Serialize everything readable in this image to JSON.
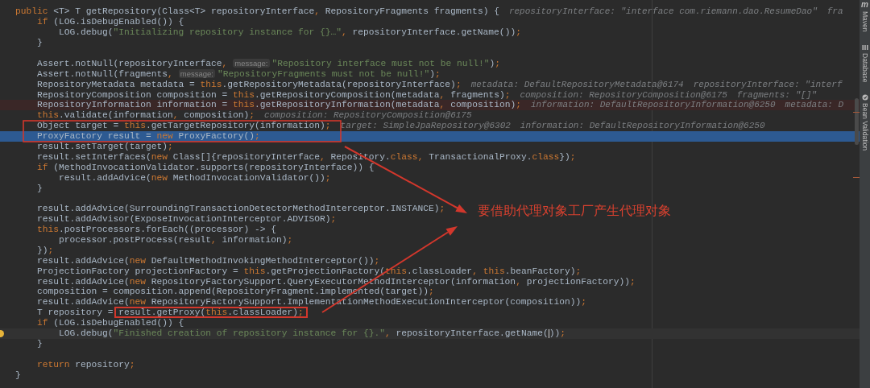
{
  "editor": {
    "lines": [
      {
        "kind": "plain",
        "tokens": [
          {
            "kind": "keyword",
            "text": "public"
          },
          {
            "kind": "plain",
            "text": " <T> T getRepository(Class<T> repositoryInterface"
          },
          {
            "kind": "keyword",
            "text": ","
          },
          {
            "kind": "plain",
            "text": " RepositoryFragments fragments) {"
          }
        ],
        "inline_values": [
          "repositoryInterface: \"interface com.riemann.dao.ResumeDao\"",
          "fra"
        ]
      },
      {
        "kind": "plain",
        "tokens": [
          {
            "kind": "keyword",
            "text": "    if"
          },
          {
            "kind": "plain",
            "text": " (LOG.isDebugEnabled()) {"
          }
        ]
      },
      {
        "kind": "plain",
        "tokens": [
          {
            "kind": "plain",
            "text": "        LOG.debug("
          },
          {
            "kind": "string",
            "text": "\"Initializing repository instance for {}…\""
          },
          {
            "kind": "keyword",
            "text": ","
          },
          {
            "kind": "plain",
            "text": " repositoryInterface.getName())"
          },
          {
            "kind": "keyword",
            "text": ";"
          }
        ]
      },
      {
        "kind": "plain",
        "tokens": [
          {
            "kind": "plain",
            "text": "    }"
          }
        ]
      },
      {
        "kind": "plain"
      },
      {
        "kind": "plain",
        "tokens": [
          {
            "kind": "plain",
            "text": "    Assert.notNull(repositoryInterface"
          },
          {
            "kind": "keyword",
            "text": ","
          },
          {
            "kind": "param_hint",
            "text": "message:"
          },
          {
            "kind": "string",
            "text": "\"Repository interface must not be null!\""
          },
          {
            "kind": "plain",
            "text": ")"
          },
          {
            "kind": "keyword",
            "text": ";"
          }
        ]
      },
      {
        "kind": "plain",
        "tokens": [
          {
            "kind": "plain",
            "text": "    Assert.notNull(fragments"
          },
          {
            "kind": "keyword",
            "text": ","
          },
          {
            "kind": "param_hint",
            "text": "message:"
          },
          {
            "kind": "string",
            "text": "\"RepositoryFragments must not be null!\""
          },
          {
            "kind": "plain",
            "text": ")"
          },
          {
            "kind": "keyword",
            "text": ";"
          }
        ]
      },
      {
        "kind": "plain",
        "tokens": [
          {
            "kind": "plain",
            "text": "    RepositoryMetadata metadata = "
          },
          {
            "kind": "keyword",
            "text": "this"
          },
          {
            "kind": "plain",
            "text": ".getRepositoryMetadata(repositoryInterface)"
          },
          {
            "kind": "keyword",
            "text": ";"
          }
        ],
        "inline_values": [
          "metadata: DefaultRepositoryMetadata@6174",
          "repositoryInterface: \"interf"
        ]
      },
      {
        "kind": "plain",
        "tokens": [
          {
            "kind": "plain",
            "text": "    RepositoryComposition composition = "
          },
          {
            "kind": "keyword",
            "text": "this"
          },
          {
            "kind": "plain",
            "text": ".getRepositoryComposition(metadata"
          },
          {
            "kind": "keyword",
            "text": ","
          },
          {
            "kind": "plain",
            "text": " fragments)"
          },
          {
            "kind": "keyword",
            "text": ";"
          }
        ],
        "inline_values": [
          "composition: RepositoryComposition@6175",
          "fragments: \"[]\""
        ]
      },
      {
        "kind": "breakpoint",
        "tokens": [
          {
            "kind": "plain",
            "text": "    RepositoryInformation information = "
          },
          {
            "kind": "keyword",
            "text": "this"
          },
          {
            "kind": "plain",
            "text": ".getRepositoryInformation(metadata"
          },
          {
            "kind": "keyword",
            "text": ","
          },
          {
            "kind": "plain",
            "text": " composition)"
          },
          {
            "kind": "keyword",
            "text": ";"
          }
        ],
        "inline_values": [
          "information: DefaultRepositoryInformation@6250",
          "metadata: D"
        ]
      },
      {
        "kind": "plain",
        "tokens": [
          {
            "kind": "keyword",
            "text": "    this"
          },
          {
            "kind": "plain",
            "text": ".validate(information"
          },
          {
            "kind": "keyword",
            "text": ","
          },
          {
            "kind": "plain",
            "text": " composition)"
          },
          {
            "kind": "keyword",
            "text": ";"
          }
        ],
        "inline_values": [
          "composition: RepositoryComposition@6175"
        ]
      },
      {
        "kind": "plain",
        "tokens": [
          {
            "kind": "plain",
            "text": "    Object target = "
          },
          {
            "kind": "keyword",
            "text": "this"
          },
          {
            "kind": "plain",
            "text": ".getTargetRepository(information)"
          },
          {
            "kind": "keyword",
            "text": ";"
          }
        ],
        "inline_values": [
          "target: SimpleJpaRepository@6302",
          "information: DefaultRepositoryInformation@6250"
        ]
      },
      {
        "kind": "execution",
        "tokens": [
          {
            "kind": "plain",
            "text": "    ProxyFactory result = "
          },
          {
            "kind": "keyword",
            "text": "new"
          },
          {
            "kind": "plain",
            "text": " ProxyFactory()"
          },
          {
            "kind": "keyword",
            "text": ";"
          }
        ]
      },
      {
        "kind": "plain",
        "tokens": [
          {
            "kind": "plain",
            "text": "    result.setTarget(target)"
          },
          {
            "kind": "keyword",
            "text": ";"
          }
        ]
      },
      {
        "kind": "plain",
        "tokens": [
          {
            "kind": "plain",
            "text": "    result.setInterfaces("
          },
          {
            "kind": "keyword",
            "text": "new"
          },
          {
            "kind": "plain",
            "text": " Class[]{repositoryInterface"
          },
          {
            "kind": "keyword",
            "text": ","
          },
          {
            "kind": "plain",
            "text": " Repository."
          },
          {
            "kind": "keyword",
            "text": "class"
          },
          {
            "kind": "keyword",
            "text": ","
          },
          {
            "kind": "plain",
            "text": " TransactionalProxy."
          },
          {
            "kind": "keyword",
            "text": "class"
          },
          {
            "kind": "plain",
            "text": "})"
          },
          {
            "kind": "keyword",
            "text": ";"
          }
        ]
      },
      {
        "kind": "plain",
        "tokens": [
          {
            "kind": "keyword",
            "text": "    if"
          },
          {
            "kind": "plain",
            "text": " (MethodInvocationValidator.supports(repositoryInterface)) {"
          }
        ]
      },
      {
        "kind": "plain",
        "tokens": [
          {
            "kind": "plain",
            "text": "        result.addAdvice("
          },
          {
            "kind": "keyword",
            "text": "new"
          },
          {
            "kind": "plain",
            "text": " MethodInvocationValidator())"
          },
          {
            "kind": "keyword",
            "text": ";"
          }
        ]
      },
      {
        "kind": "plain",
        "tokens": [
          {
            "kind": "plain",
            "text": "    }"
          }
        ]
      },
      {
        "kind": "plain"
      },
      {
        "kind": "plain",
        "tokens": [
          {
            "kind": "plain",
            "text": "    result.addAdvice(SurroundingTransactionDetectorMethodInterceptor.INSTANCE)"
          },
          {
            "kind": "keyword",
            "text": ";"
          }
        ]
      },
      {
        "kind": "plain",
        "tokens": [
          {
            "kind": "plain",
            "text": "    result.addAdvisor(ExposeInvocationInterceptor.ADVISOR)"
          },
          {
            "kind": "keyword",
            "text": ";"
          }
        ]
      },
      {
        "kind": "plain",
        "tokens": [
          {
            "kind": "keyword",
            "text": "    this"
          },
          {
            "kind": "plain",
            "text": ".postProcessors.forEach((processor) -> {"
          }
        ]
      },
      {
        "kind": "plain",
        "tokens": [
          {
            "kind": "plain",
            "text": "        processor.postProcess(result"
          },
          {
            "kind": "keyword",
            "text": ","
          },
          {
            "kind": "plain",
            "text": " information)"
          },
          {
            "kind": "keyword",
            "text": ";"
          }
        ]
      },
      {
        "kind": "plain",
        "tokens": [
          {
            "kind": "plain",
            "text": "    })"
          },
          {
            "kind": "keyword",
            "text": ";"
          }
        ]
      },
      {
        "kind": "plain",
        "tokens": [
          {
            "kind": "plain",
            "text": "    result.addAdvice("
          },
          {
            "kind": "keyword",
            "text": "new"
          },
          {
            "kind": "plain",
            "text": " DefaultMethodInvokingMethodInterceptor())"
          },
          {
            "kind": "keyword",
            "text": ";"
          }
        ]
      },
      {
        "kind": "plain",
        "tokens": [
          {
            "kind": "plain",
            "text": "    ProjectionFactory projectionFactory = "
          },
          {
            "kind": "keyword",
            "text": "this"
          },
          {
            "kind": "plain",
            "text": ".getProjectionFactory("
          },
          {
            "kind": "keyword",
            "text": "this"
          },
          {
            "kind": "plain",
            "text": ".classLoader"
          },
          {
            "kind": "keyword",
            "text": ", this"
          },
          {
            "kind": "plain",
            "text": ".beanFactory)"
          },
          {
            "kind": "keyword",
            "text": ";"
          }
        ]
      },
      {
        "kind": "plain",
        "tokens": [
          {
            "kind": "plain",
            "text": "    result.addAdvice("
          },
          {
            "kind": "keyword",
            "text": "new"
          },
          {
            "kind": "plain",
            "text": " RepositoryFactorySupport.QueryExecutorMethodInterceptor(information"
          },
          {
            "kind": "keyword",
            "text": ","
          },
          {
            "kind": "plain",
            "text": " projectionFactory))"
          },
          {
            "kind": "keyword",
            "text": ";"
          }
        ]
      },
      {
        "kind": "plain",
        "tokens": [
          {
            "kind": "plain",
            "text": "    composition = composition.append(RepositoryFragment.implemented(target))"
          },
          {
            "kind": "keyword",
            "text": ";"
          }
        ]
      },
      {
        "kind": "plain",
        "tokens": [
          {
            "kind": "plain",
            "text": "    result.addAdvice("
          },
          {
            "kind": "keyword",
            "text": "new"
          },
          {
            "kind": "plain",
            "text": " RepositoryFactorySupport.ImplementationMethodExecutionInterceptor(composition))"
          },
          {
            "kind": "keyword",
            "text": ";"
          }
        ]
      },
      {
        "kind": "plain",
        "tokens": [
          {
            "kind": "plain",
            "text": "    T repository = "
          },
          {
            "kind": "plain",
            "text": "result.getProxy(",
            "framed": true
          },
          {
            "kind": "keyword",
            "text": "this",
            "framed": true
          },
          {
            "kind": "plain",
            "text": ".classLoader)",
            "framed": true
          },
          {
            "kind": "keyword",
            "text": ";",
            "framed": true
          }
        ]
      },
      {
        "kind": "plain",
        "tokens": [
          {
            "kind": "keyword",
            "text": "    if"
          },
          {
            "kind": "plain",
            "text": " (LOG.isDebugEnabled()) {"
          }
        ]
      },
      {
        "kind": "caret",
        "intention_bulb": true,
        "tokens": [
          {
            "kind": "plain",
            "text": "        LOG.debug("
          },
          {
            "kind": "string",
            "text": "\"Finished creation of repository instance for {}.\""
          },
          {
            "kind": "keyword",
            "text": ","
          },
          {
            "kind": "plain",
            "text": " repositoryInterface.getName("
          },
          {
            "kind": "caret"
          },
          {
            "kind": "plain",
            "text": "))"
          },
          {
            "kind": "keyword",
            "text": ";"
          }
        ]
      },
      {
        "kind": "plain",
        "tokens": [
          {
            "kind": "plain",
            "text": "    }"
          }
        ]
      },
      {
        "kind": "plain"
      },
      {
        "kind": "plain",
        "tokens": [
          {
            "kind": "keyword",
            "text": "    return"
          },
          {
            "kind": "plain",
            "text": " repository"
          },
          {
            "kind": "keyword",
            "text": ";"
          }
        ]
      },
      {
        "kind": "plain",
        "tokens": [
          {
            "kind": "plain",
            "text": "}"
          }
        ]
      }
    ]
  },
  "annotation": {
    "note": "要借助代理对象工厂产生代理对象"
  },
  "tool_windows": [
    {
      "kind": "maven",
      "icon_text": "m",
      "label": "Maven"
    },
    {
      "kind": "database",
      "label": "Database"
    },
    {
      "kind": "bean",
      "label": "Bean Validation"
    }
  ]
}
